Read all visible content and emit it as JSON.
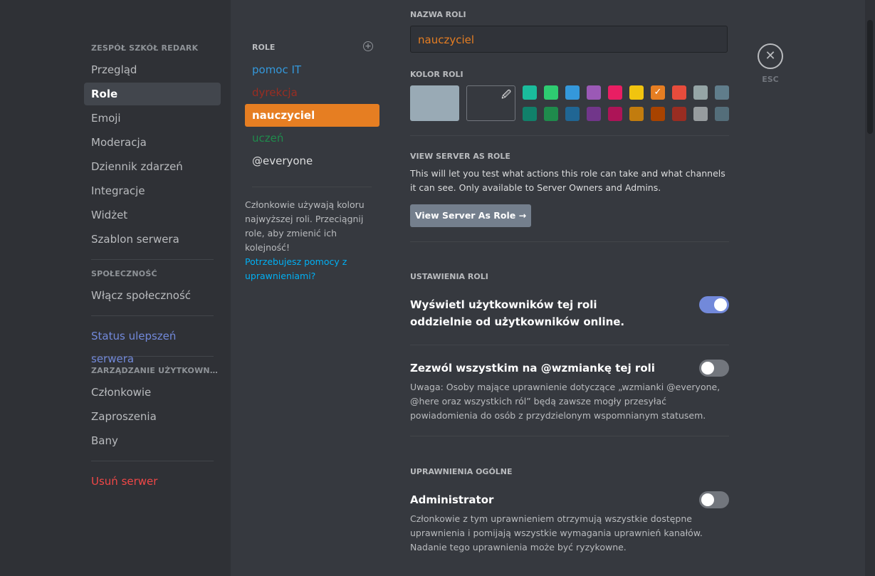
{
  "sidebar": {
    "sections": [
      {
        "header": "ZESPÓŁ SZKÓŁ REDARK",
        "items": [
          {
            "label": "Przegląd"
          },
          {
            "label": "Role",
            "selected": true
          },
          {
            "label": "Emoji"
          },
          {
            "label": "Moderacja"
          },
          {
            "label": "Dziennik zdarzeń"
          },
          {
            "label": "Integracje"
          },
          {
            "label": "Widżet"
          },
          {
            "label": "Szablon serwera"
          }
        ]
      },
      {
        "header": "SPOŁECZNOŚĆ",
        "items": [
          {
            "label": "Włącz społeczność"
          }
        ]
      },
      {
        "header": "",
        "items": [
          {
            "label": "Status ulepszeń serwera",
            "style": "blue"
          }
        ]
      },
      {
        "header": "ZARZĄDZANIE UŻYTKOWNIKAMI",
        "items": [
          {
            "label": "Członkowie"
          },
          {
            "label": "Zaproszenia"
          },
          {
            "label": "Bany"
          }
        ]
      },
      {
        "header": "",
        "items": [
          {
            "label": "Usuń serwer",
            "style": "red"
          }
        ]
      }
    ]
  },
  "roles": {
    "header": "ROLE",
    "add_icon": "plus-circle-icon",
    "items": [
      {
        "label": "pomoc IT",
        "color": "#3498db"
      },
      {
        "label": "dyrekcja",
        "color": "#992d22"
      },
      {
        "label": "nauczyciel",
        "color": "#e67e22",
        "selected": true
      },
      {
        "label": "uczeń",
        "color": "#1f8b4c"
      },
      {
        "label": "@everyone",
        "color": "#dcddde"
      }
    ],
    "hint": "Członkowie używają koloru najwyższej roli. Przeciągnij role, aby zmienić ich kolejność!",
    "help_link": "Potrzebujesz pomocy z uprawnieniami?"
  },
  "editor": {
    "name_label": "NAZWA ROLI",
    "name_value": "nauczyciel",
    "color_label": "KOLOR ROLI",
    "default_color": "#99aab5",
    "custom_color_icon": "eyedropper-icon",
    "palette_row1": [
      "#1abc9c",
      "#2ecc71",
      "#3498db",
      "#9b59b6",
      "#e91e63",
      "#f1c40f",
      "#e67e22",
      "#e74c3c",
      "#95a5a6",
      "#607d8b"
    ],
    "palette_row2": [
      "#11806a",
      "#1f8b4c",
      "#206694",
      "#71368a",
      "#ad1457",
      "#c27c0e",
      "#a84300",
      "#992d22",
      "#979c9f",
      "#546e7a"
    ],
    "selected_color_index": 6,
    "view_as_role": {
      "header": "VIEW SERVER AS ROLE",
      "description": "This will let you test what actions this role can take and what channels it can see. Only available to Server Owners and Admins.",
      "button": "View Server As Role →"
    },
    "settings_header": "USTAWIENIA ROLI",
    "hoist": {
      "title": "Wyświetl użytkowników tej roli oddzielnie od użytkowników online.",
      "enabled": true
    },
    "mentionable": {
      "title": "Zezwól wszystkim na @wzmiankę tej roli",
      "description": "Uwaga: Osoby mające uprawnienie dotyczące „wzmianki @everyone, @here oraz wszystkich ról” będą zawsze mogły przesyłać powiadomienia do osób z przydzielonym wspomnianym statusem.",
      "enabled": false
    },
    "general_header": "UPRAWNIENIA OGÓLNE",
    "administrator": {
      "title": "Administrator",
      "description": "Członkowie z tym uprawnieniem otrzymują wszystkie dostępne uprawnienia i pomijają wszystkie wymagania uprawnień kanałów. Nadanie tego uprawnienia może być ryzykowne.",
      "enabled": false
    }
  },
  "close": {
    "icon": "close-icon",
    "label": "ESC"
  },
  "colors": {
    "toggle_on": "#7289da",
    "toggle_off": "#72767d",
    "accent": "#e67e22"
  }
}
